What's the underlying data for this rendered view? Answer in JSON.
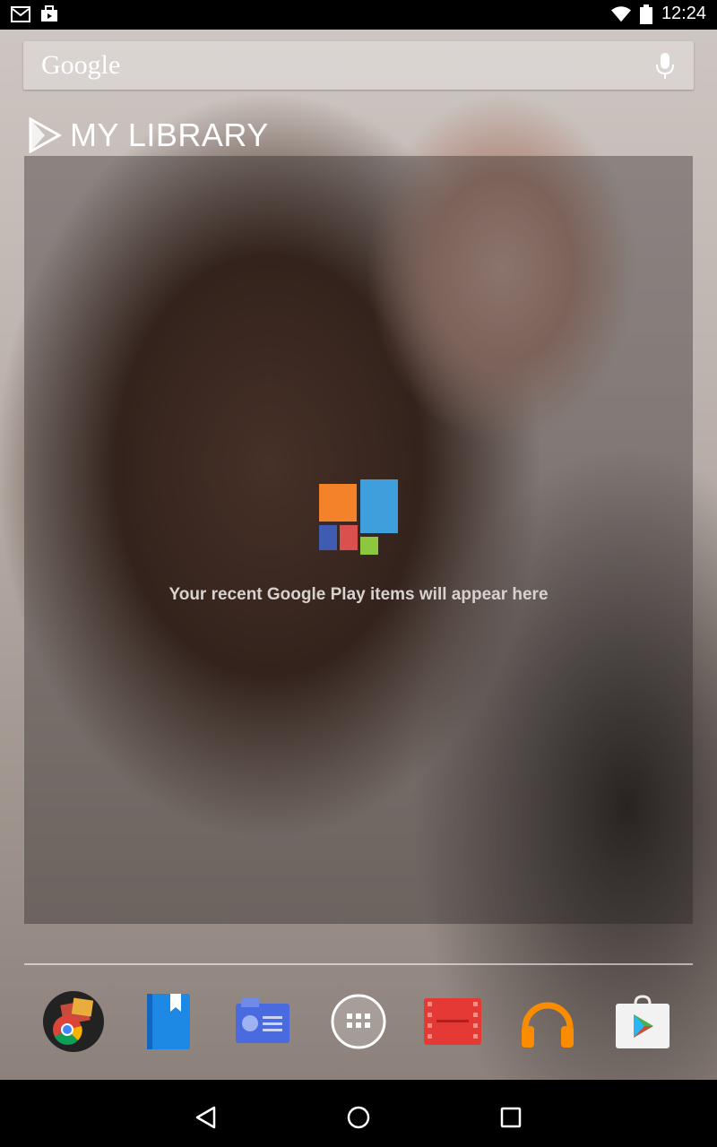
{
  "status_bar": {
    "time": "12:24",
    "left_icons": [
      "gmail-icon",
      "briefcase-icon"
    ],
    "right_icons": [
      "wifi-icon",
      "battery-icon"
    ]
  },
  "search": {
    "logo_text": "Google",
    "mic_icon": "mic-icon"
  },
  "library_widget": {
    "title": "MY LIBRARY",
    "empty_message": "Your recent Google Play items will appear here",
    "tile_colors": [
      "#F4822A",
      "#3F9FDC",
      "#3F5CB2",
      "#D9504F",
      "#8DC63F"
    ]
  },
  "dock": {
    "apps": [
      {
        "name": "chrome-icon"
      },
      {
        "name": "play-books-icon"
      },
      {
        "name": "play-newsstand-icon"
      },
      {
        "name": "all-apps-icon"
      },
      {
        "name": "play-movies-icon"
      },
      {
        "name": "play-music-icon"
      },
      {
        "name": "play-store-icon"
      }
    ]
  },
  "nav": {
    "buttons": [
      "back-icon",
      "home-icon",
      "recents-icon"
    ]
  }
}
